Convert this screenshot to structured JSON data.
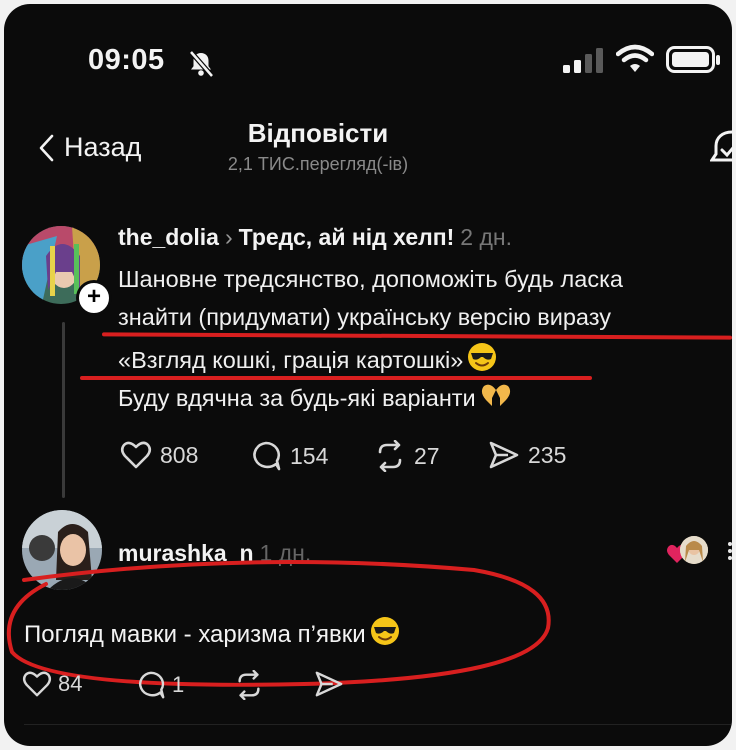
{
  "status_bar": {
    "time": "09:05"
  },
  "nav": {
    "back_label": "Назад",
    "title": "Відповісти",
    "subtitle": "2,1 ТИС.перегляд(-ів)"
  },
  "post": {
    "username": "the_dolia",
    "topic": "Тредс, ай нід хелп!",
    "age": "2 дн.",
    "lines": [
      "Шановне тредсянство, допоможіть будь ласка",
      "знайти (придумати) українську версію виразу",
      "«Взгляд кошкі, грація картошкі»",
      "Буду вдячна за будь-які варіанти"
    ],
    "stats": {
      "likes": "808",
      "replies": "154",
      "reposts": "27",
      "shares": "235"
    }
  },
  "reply": {
    "username": "murashka_n",
    "age": "1 дн.",
    "text": "Погляд мавки - харизма п’явки",
    "stats": {
      "likes": "84",
      "replies": "1"
    }
  },
  "colors": {
    "background": "#0b0b0b",
    "text": "#f3f3f3",
    "muted": "#8a8a8a",
    "annotation_red": "#d81f1f",
    "heart_red": "#e0245e"
  },
  "icons": [
    "bell-off-icon",
    "signal-icon",
    "wifi-icon",
    "battery-icon",
    "chevron-left-icon",
    "heart-icon",
    "comment-icon",
    "repost-icon",
    "share-icon",
    "smiling-face-with-sunglasses-icon",
    "heart-hands-icon",
    "more-icon"
  ]
}
